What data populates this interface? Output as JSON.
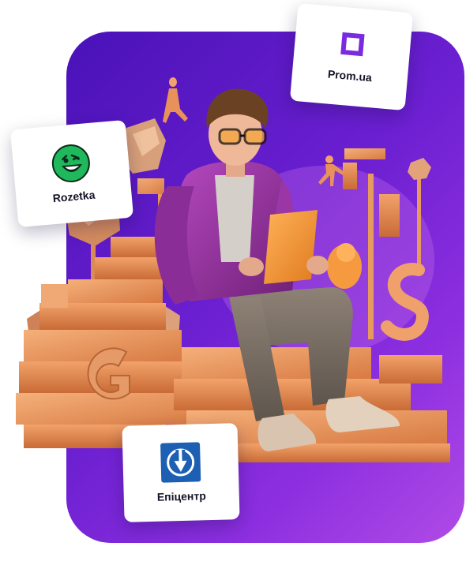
{
  "cards": {
    "rozetka": {
      "label": "Rozetka",
      "icon": "rozetka-smiley-icon",
      "accent": "#1fb85c"
    },
    "prom": {
      "label": "Prom.ua",
      "icon": "prom-square-icon",
      "accent": "#7a2ae0"
    },
    "epicentr": {
      "label": "Епіцентр",
      "icon": "epicentr-arrow-icon",
      "accent": "#1d5fb3"
    }
  },
  "colors": {
    "backdrop_start": "#4a12b8",
    "backdrop_end": "#b04be6",
    "block_orange": "#e8915a",
    "jacket": "#9a3aa8"
  }
}
